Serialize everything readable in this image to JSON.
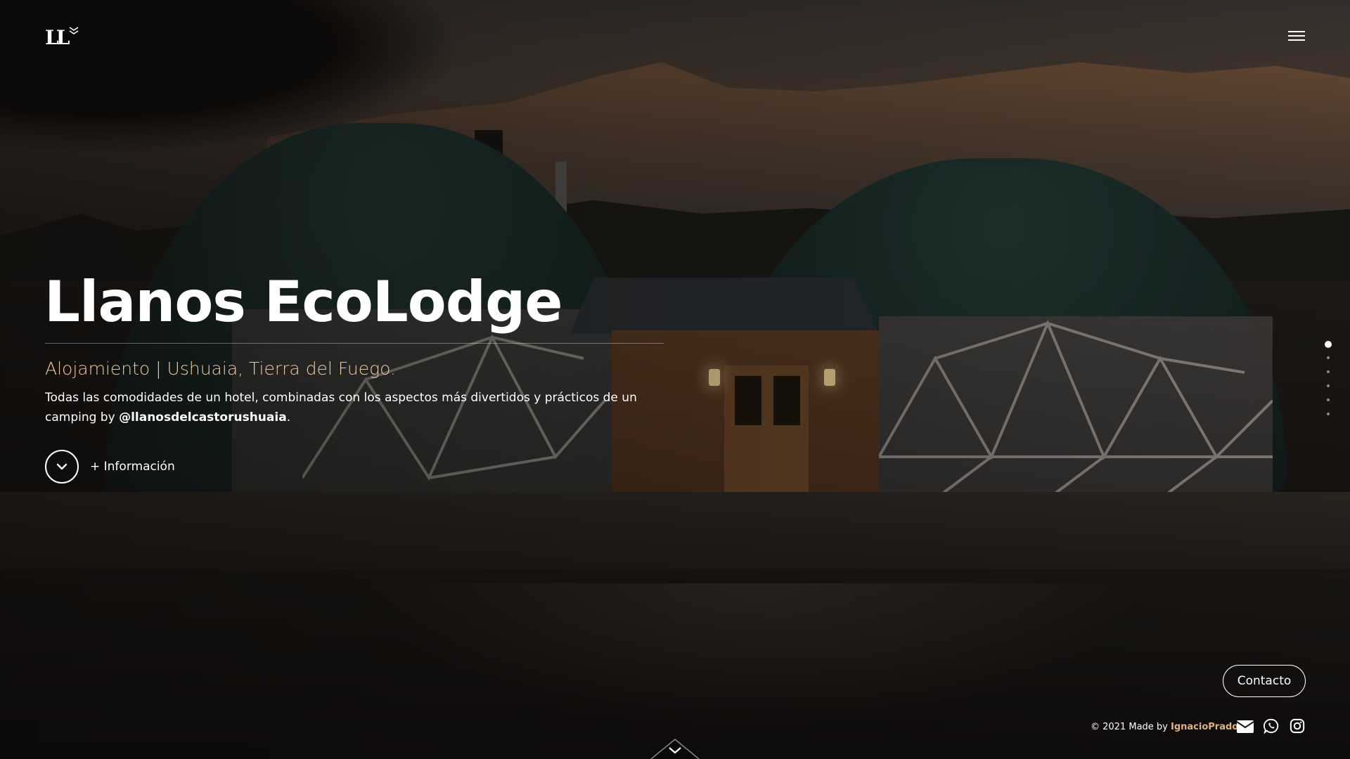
{
  "brand": {
    "logo_text": "LL"
  },
  "hero": {
    "title": "Llanos EcoLodge",
    "subtitle": "Alojamiento | Ushuaia, Tierra del Fuego.",
    "description_prefix": "Todas las comodidades de un hotel, combinadas con los aspectos más divertidos y prácticos de un camping by",
    "handle": "@llanosdelcastorushuaia",
    "description_suffix": ".",
    "more_info_label": "+ Información"
  },
  "pagination": {
    "count": 6,
    "active_index": 0
  },
  "contact": {
    "label": "Contacto"
  },
  "footer": {
    "credit_prefix": "© 2021 Made by",
    "author": "IgnacioPrados"
  },
  "icons": {
    "menu": "hamburger-menu-icon",
    "more_info": "chevron-down-icon",
    "email": "envelope-icon",
    "whatsapp": "whatsapp-icon",
    "instagram": "instagram-icon",
    "scroll": "chevron-down-icon"
  },
  "colors": {
    "accent": "#e7c9a2",
    "author_link": "#e0b37e",
    "text": "#ffffff"
  }
}
